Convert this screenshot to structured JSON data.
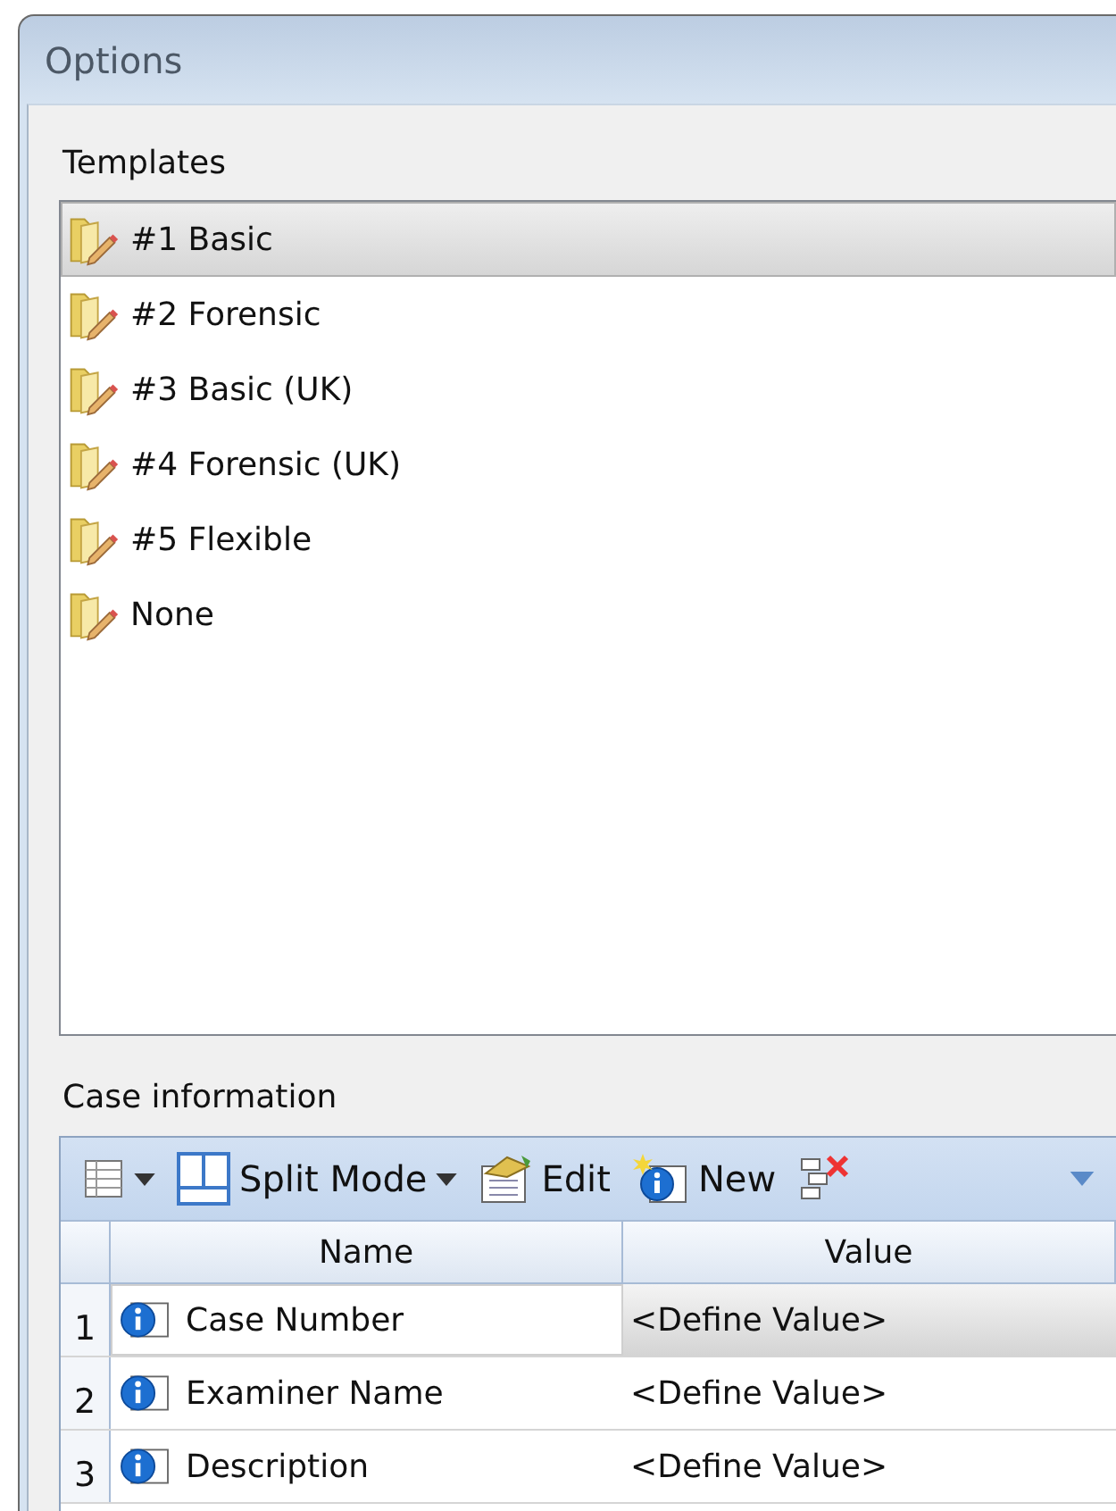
{
  "window": {
    "title": "Options"
  },
  "templates": {
    "label": "Templates",
    "items": [
      {
        "label": "#1 Basic",
        "selected": true
      },
      {
        "label": "#2 Forensic",
        "selected": false
      },
      {
        "label": "#3 Basic (UK)",
        "selected": false
      },
      {
        "label": "#4 Forensic (UK)",
        "selected": false
      },
      {
        "label": "#5 Flexible",
        "selected": false
      },
      {
        "label": "None",
        "selected": false
      }
    ]
  },
  "case_information": {
    "label": "Case information",
    "toolbar": [
      {
        "kind": "grid-menu"
      },
      {
        "kind": "split",
        "label": "Split Mode"
      },
      {
        "kind": "edit",
        "label": "Edit"
      },
      {
        "kind": "new",
        "label": "New"
      },
      {
        "kind": "delete"
      },
      {
        "kind": "overflow"
      }
    ],
    "columns": [
      "Name",
      "Value"
    ],
    "rows": [
      {
        "number": "1",
        "name": "Case Number",
        "value": "<Define Value>",
        "selected": true
      },
      {
        "number": "2",
        "name": "Examiner Name",
        "value": "<Define Value>",
        "selected": false
      },
      {
        "number": "3",
        "name": "Description",
        "value": "<Define Value>",
        "selected": false
      }
    ]
  }
}
